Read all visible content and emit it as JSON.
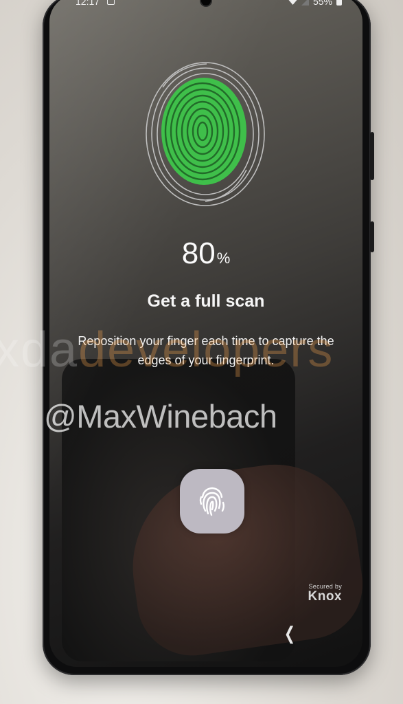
{
  "status_bar": {
    "time": "12:17",
    "battery": "55%",
    "icons": [
      "notification-icon",
      "wifi-icon",
      "signal-icon",
      "battery-icon"
    ]
  },
  "enrollment": {
    "progress_value": "80",
    "progress_unit": "%",
    "title": "Get a full scan",
    "instruction": "Reposition your finger each time to capture the edges of your fingerprint."
  },
  "knox": {
    "secured_by": "Secured by",
    "brand": "Knox"
  },
  "watermarks": {
    "site_left": "xda",
    "site_right": "developers",
    "handle": "@MaxWinebach"
  },
  "colors": {
    "fingerprint_progress": "#3fbf4a",
    "fingerprint_outline": "#bfbfbf",
    "sensor_button": "#bdb9c2"
  }
}
